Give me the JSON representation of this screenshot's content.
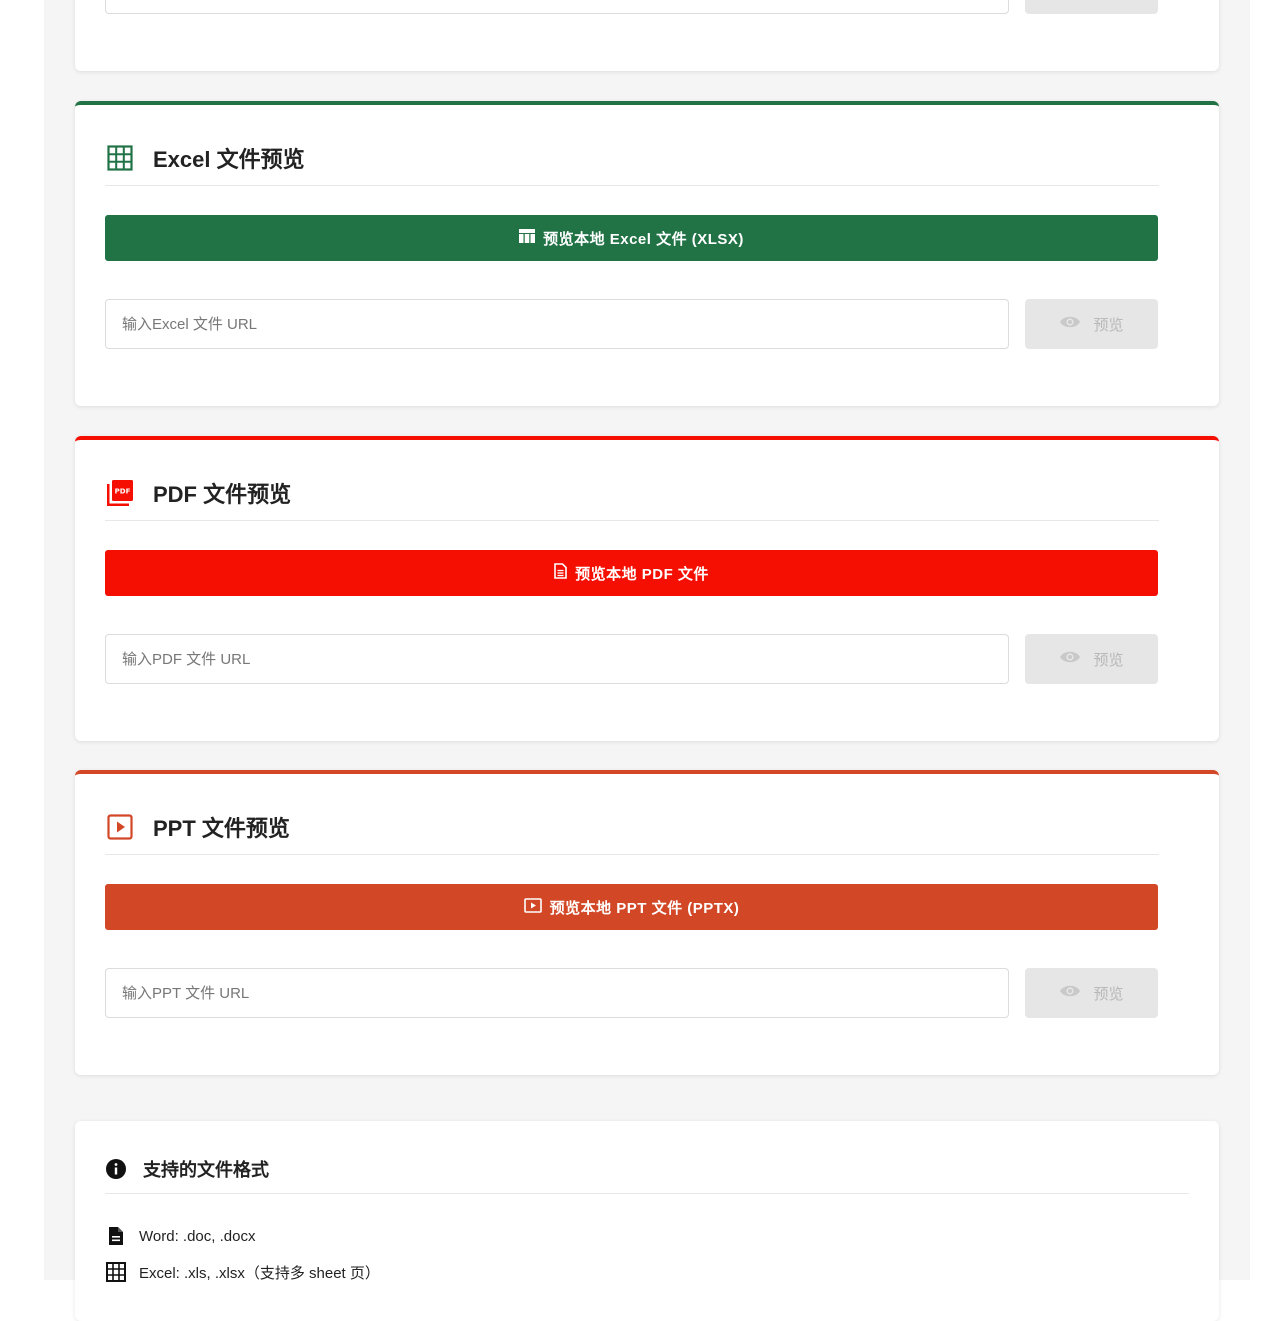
{
  "colors": {
    "excel": "#217346",
    "pdf": "#f40f02",
    "ppt": "#d24726"
  },
  "top_card": {
    "preview_label": ""
  },
  "excel": {
    "title": "Excel 文件预览",
    "icon": "table-grid-icon",
    "local_button": "预览本地 Excel 文件 (XLSX)",
    "local_button_icon": "table-icon",
    "url_placeholder": "输入Excel 文件 URL",
    "preview_label": "预览"
  },
  "pdf": {
    "title": "PDF 文件预览",
    "icon": "pdf-icon",
    "local_button": "预览本地 PDF 文件",
    "local_button_icon": "document-icon",
    "url_placeholder": "输入PDF 文件 URL",
    "preview_label": "预览"
  },
  "ppt": {
    "title": "PPT 文件预览",
    "icon": "slideshow-icon",
    "local_button": "预览本地 PPT 文件 (PPTX)",
    "local_button_icon": "presentation-icon",
    "url_placeholder": "输入PPT 文件 URL",
    "preview_label": "预览"
  },
  "formats": {
    "title": "支持的文件格式",
    "icon": "info-icon",
    "items": [
      {
        "icon": "document-icon",
        "text": "Word: .doc, .docx"
      },
      {
        "icon": "table-grid-icon",
        "text": "Excel: .xls, .xlsx（支持多 sheet 页）"
      }
    ]
  }
}
